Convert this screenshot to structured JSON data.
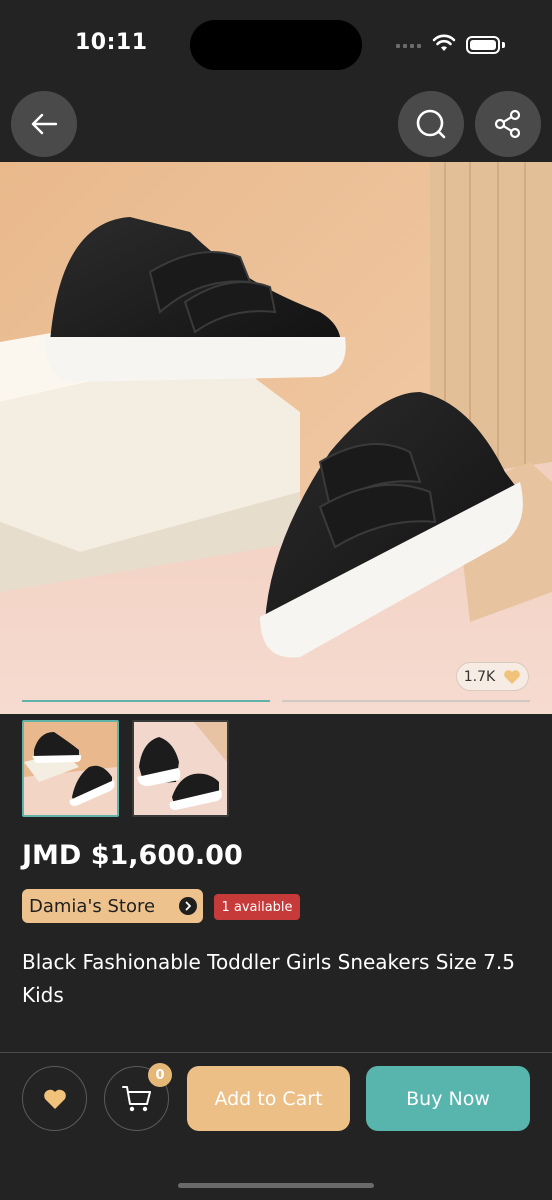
{
  "status_bar": {
    "time": "10:11"
  },
  "nav": {
    "back_icon": "arrow-left-icon",
    "search_icon": "search-icon",
    "share_icon": "share-icon"
  },
  "product": {
    "likes": "1.7K",
    "price": "JMD $1,600.00",
    "store": "Damia's Store",
    "availability": "1 available",
    "title": "Black Fashionable Toddler Girls Sneakers Size 7.5 Kids",
    "image_count": 2,
    "selected_image": 1
  },
  "actions": {
    "cart_count": "0",
    "add_to_cart": "Add to Cart",
    "buy_now": "Buy Now"
  },
  "colors": {
    "background": "#232323",
    "accent_teal": "#57b5ad",
    "accent_gold": "#ecbf86",
    "availability_red": "#c73a3a"
  }
}
